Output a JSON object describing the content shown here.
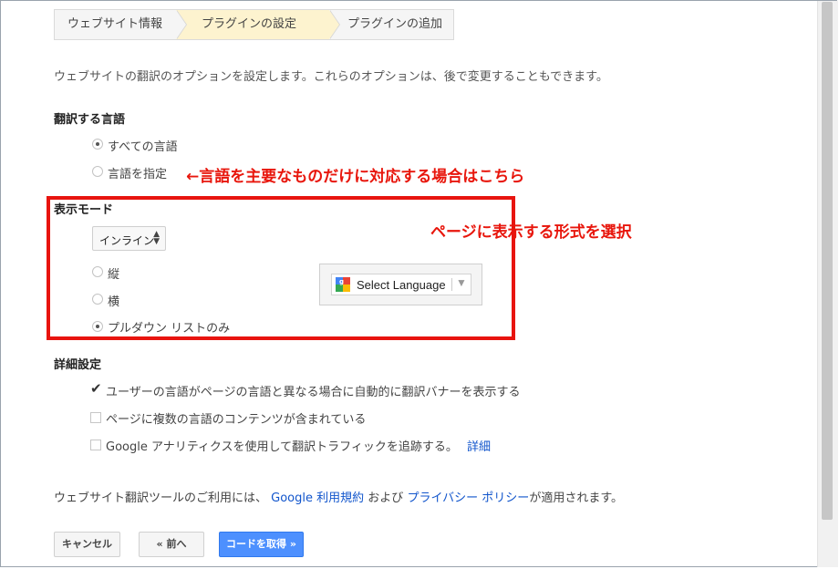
{
  "steps": [
    {
      "label": "ウェブサイト情報"
    },
    {
      "label": "プラグインの設定"
    },
    {
      "label": "プラグインの追加"
    }
  ],
  "intro": "ウェブサイトの翻訳のオプションを設定します。これらのオプションは、後で変更することもできます。",
  "languages": {
    "heading": "翻訳する言語",
    "options": [
      "すべての言語",
      "言語を指定"
    ],
    "selected": "すべての言語",
    "annotation": "←言語を主要なものだけに対応する場合はこちら"
  },
  "display_mode": {
    "heading": "表示モード",
    "select_value": "インライン",
    "options": [
      "縦",
      "横",
      "プルダウン リストのみ"
    ],
    "selected": "プルダウン リストのみ",
    "annotation": "ページに表示する形式を選択",
    "preview_label": "Select Language"
  },
  "advanced": {
    "heading": "詳細設定",
    "options": [
      {
        "label": "ユーザーの言語がページの言語と異なる場合に自動的に翻訳バナーを表示する",
        "checked": true
      },
      {
        "label": "ページに複数の言語のコンテンツが含まれている",
        "checked": false
      },
      {
        "label": "Google アナリティクスを使用して翻訳トラフィックを追跡する。",
        "checked": false,
        "link": "詳細"
      }
    ]
  },
  "terms": {
    "prefix": "ウェブサイト翻訳ツールのご利用には、",
    "link1": "Google 利用規約",
    "middle": "および",
    "link2": "プライバシー ポリシー",
    "suffix": "が適用されます。"
  },
  "buttons": {
    "cancel": "キャンセル",
    "back": "« 前へ",
    "get_code": "コードを取得 »"
  },
  "colors": {
    "annotation_red": "#e8160c",
    "link_blue": "#1155cc",
    "primary_button": "#4d90fe",
    "active_step": "#fdf3cf"
  }
}
